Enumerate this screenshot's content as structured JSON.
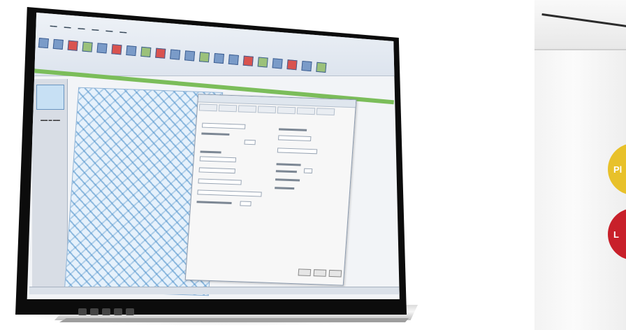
{
  "scene": {
    "colors": {
      "background": "#ffffff",
      "ribbon": "#dde4ee",
      "accent_green": "#7bbd5a",
      "pattern_blue": "#468cc8",
      "badge_yellow": "#e8c12a",
      "badge_red": "#c8202a"
    },
    "badges": [
      {
        "text": "Pl"
      },
      {
        "text": "L"
      }
    ],
    "dock_icons": [
      "app-icon",
      "app-icon",
      "app-icon",
      "app-icon",
      "app-icon"
    ]
  }
}
